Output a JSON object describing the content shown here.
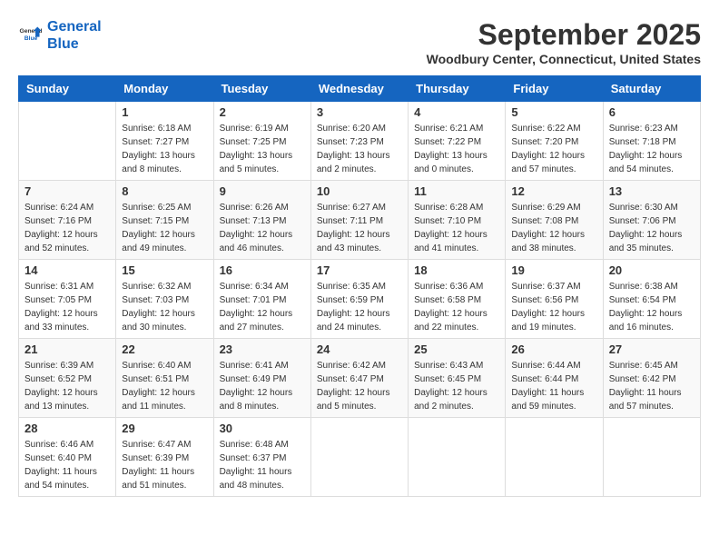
{
  "logo": {
    "line1": "General",
    "line2": "Blue"
  },
  "title": "September 2025",
  "location": "Woodbury Center, Connecticut, United States",
  "days_of_week": [
    "Sunday",
    "Monday",
    "Tuesday",
    "Wednesday",
    "Thursday",
    "Friday",
    "Saturday"
  ],
  "weeks": [
    [
      {
        "day": "",
        "info": ""
      },
      {
        "day": "1",
        "info": "Sunrise: 6:18 AM\nSunset: 7:27 PM\nDaylight: 13 hours\nand 8 minutes."
      },
      {
        "day": "2",
        "info": "Sunrise: 6:19 AM\nSunset: 7:25 PM\nDaylight: 13 hours\nand 5 minutes."
      },
      {
        "day": "3",
        "info": "Sunrise: 6:20 AM\nSunset: 7:23 PM\nDaylight: 13 hours\nand 2 minutes."
      },
      {
        "day": "4",
        "info": "Sunrise: 6:21 AM\nSunset: 7:22 PM\nDaylight: 13 hours\nand 0 minutes."
      },
      {
        "day": "5",
        "info": "Sunrise: 6:22 AM\nSunset: 7:20 PM\nDaylight: 12 hours\nand 57 minutes."
      },
      {
        "day": "6",
        "info": "Sunrise: 6:23 AM\nSunset: 7:18 PM\nDaylight: 12 hours\nand 54 minutes."
      }
    ],
    [
      {
        "day": "7",
        "info": "Sunrise: 6:24 AM\nSunset: 7:16 PM\nDaylight: 12 hours\nand 52 minutes."
      },
      {
        "day": "8",
        "info": "Sunrise: 6:25 AM\nSunset: 7:15 PM\nDaylight: 12 hours\nand 49 minutes."
      },
      {
        "day": "9",
        "info": "Sunrise: 6:26 AM\nSunset: 7:13 PM\nDaylight: 12 hours\nand 46 minutes."
      },
      {
        "day": "10",
        "info": "Sunrise: 6:27 AM\nSunset: 7:11 PM\nDaylight: 12 hours\nand 43 minutes."
      },
      {
        "day": "11",
        "info": "Sunrise: 6:28 AM\nSunset: 7:10 PM\nDaylight: 12 hours\nand 41 minutes."
      },
      {
        "day": "12",
        "info": "Sunrise: 6:29 AM\nSunset: 7:08 PM\nDaylight: 12 hours\nand 38 minutes."
      },
      {
        "day": "13",
        "info": "Sunrise: 6:30 AM\nSunset: 7:06 PM\nDaylight: 12 hours\nand 35 minutes."
      }
    ],
    [
      {
        "day": "14",
        "info": "Sunrise: 6:31 AM\nSunset: 7:05 PM\nDaylight: 12 hours\nand 33 minutes."
      },
      {
        "day": "15",
        "info": "Sunrise: 6:32 AM\nSunset: 7:03 PM\nDaylight: 12 hours\nand 30 minutes."
      },
      {
        "day": "16",
        "info": "Sunrise: 6:34 AM\nSunset: 7:01 PM\nDaylight: 12 hours\nand 27 minutes."
      },
      {
        "day": "17",
        "info": "Sunrise: 6:35 AM\nSunset: 6:59 PM\nDaylight: 12 hours\nand 24 minutes."
      },
      {
        "day": "18",
        "info": "Sunrise: 6:36 AM\nSunset: 6:58 PM\nDaylight: 12 hours\nand 22 minutes."
      },
      {
        "day": "19",
        "info": "Sunrise: 6:37 AM\nSunset: 6:56 PM\nDaylight: 12 hours\nand 19 minutes."
      },
      {
        "day": "20",
        "info": "Sunrise: 6:38 AM\nSunset: 6:54 PM\nDaylight: 12 hours\nand 16 minutes."
      }
    ],
    [
      {
        "day": "21",
        "info": "Sunrise: 6:39 AM\nSunset: 6:52 PM\nDaylight: 12 hours\nand 13 minutes."
      },
      {
        "day": "22",
        "info": "Sunrise: 6:40 AM\nSunset: 6:51 PM\nDaylight: 12 hours\nand 11 minutes."
      },
      {
        "day": "23",
        "info": "Sunrise: 6:41 AM\nSunset: 6:49 PM\nDaylight: 12 hours\nand 8 minutes."
      },
      {
        "day": "24",
        "info": "Sunrise: 6:42 AM\nSunset: 6:47 PM\nDaylight: 12 hours\nand 5 minutes."
      },
      {
        "day": "25",
        "info": "Sunrise: 6:43 AM\nSunset: 6:45 PM\nDaylight: 12 hours\nand 2 minutes."
      },
      {
        "day": "26",
        "info": "Sunrise: 6:44 AM\nSunset: 6:44 PM\nDaylight: 11 hours\nand 59 minutes."
      },
      {
        "day": "27",
        "info": "Sunrise: 6:45 AM\nSunset: 6:42 PM\nDaylight: 11 hours\nand 57 minutes."
      }
    ],
    [
      {
        "day": "28",
        "info": "Sunrise: 6:46 AM\nSunset: 6:40 PM\nDaylight: 11 hours\nand 54 minutes."
      },
      {
        "day": "29",
        "info": "Sunrise: 6:47 AM\nSunset: 6:39 PM\nDaylight: 11 hours\nand 51 minutes."
      },
      {
        "day": "30",
        "info": "Sunrise: 6:48 AM\nSunset: 6:37 PM\nDaylight: 11 hours\nand 48 minutes."
      },
      {
        "day": "",
        "info": ""
      },
      {
        "day": "",
        "info": ""
      },
      {
        "day": "",
        "info": ""
      },
      {
        "day": "",
        "info": ""
      }
    ]
  ]
}
